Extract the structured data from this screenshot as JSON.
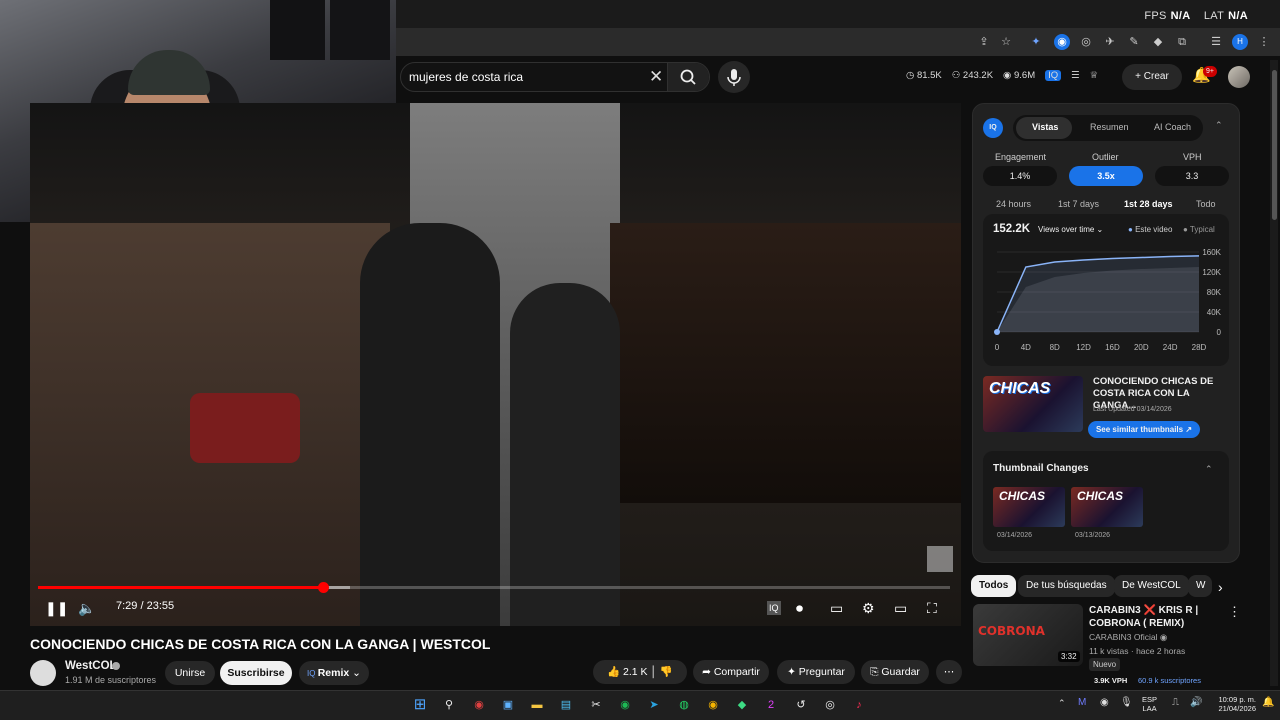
{
  "overlay": {
    "fps_label": "FPS",
    "fps_value": "N/A",
    "lat_label": "LAT",
    "lat_value": "N/A"
  },
  "search": {
    "query": "mujeres de costa rica"
  },
  "header": {
    "stats": [
      "81.5K",
      "243.2K",
      "9.6M"
    ],
    "create_label": "Crear",
    "notifications": "9+"
  },
  "player": {
    "time": "7:29 / 23:55",
    "progress_fraction": 0.313,
    "buffer_fraction": 0.342
  },
  "video": {
    "title": "CONOCIENDO CHICAS DE COSTA RICA CON LA GANGA | WESTCOL",
    "channel": "WestCOL",
    "subscribers": "1.91 M de suscriptores",
    "join_label": "Unirse",
    "subscribe_label": "Suscribirse",
    "remix_label": "Remix",
    "likes": "2.1 K",
    "share_label": "Compartir",
    "ask_label": "Preguntar",
    "save_label": "Guardar"
  },
  "iq": {
    "logo": "IQ",
    "tabs": [
      "Vistas",
      "Resumen",
      "AI Coach"
    ],
    "metrics": [
      {
        "label": "Engagement",
        "value": "1.4%"
      },
      {
        "label": "Outlier",
        "value": "3.5x"
      },
      {
        "label": "VPH",
        "value": "3.3"
      }
    ],
    "ranges": [
      "24 hours",
      "1st 7 days",
      "1st 28 days",
      "Todo"
    ],
    "chart_views": "152.2K",
    "chart_mode": "Views over time",
    "legend_this": "Este video",
    "legend_typical": "Typical",
    "thumb_title": "CONOCIENDO CHICAS DE COSTA RICA CON LA GANGA...",
    "thumb_updated": "Last Updated 03/14/2026",
    "similar_label": "See similar thumbnails",
    "changes_title": "Thumbnail Changes",
    "change_dates": [
      "03/14/2026",
      "03/13/2026"
    ],
    "thumb_text": "CHICAS"
  },
  "chart_data": {
    "type": "area",
    "title": "",
    "x": [
      "0",
      "4D",
      "8D",
      "12D",
      "16D",
      "20D",
      "24D",
      "28D"
    ],
    "y_ticks": [
      "160K",
      "120K",
      "80K",
      "40K",
      "0"
    ],
    "ylim": [
      0,
      160000
    ],
    "series": [
      {
        "name": "Este video",
        "values": [
          0,
          130000,
          140000,
          144000,
          147000,
          149000,
          151000,
          152200
        ]
      },
      {
        "values": [
          0,
          90000,
          110000,
          118000,
          123000,
          126000,
          128000,
          130000
        ]
      }
    ],
    "grid": true,
    "legend": "top-right"
  },
  "chips": [
    "Todos",
    "De tus búsquedas",
    "De WestCOL",
    "W"
  ],
  "recommended": {
    "title": "CARABIN3 ❌ KRIS R | COBRONA ( REMIX)",
    "thumb_text": "COBRONA",
    "channel": "CARABIN3 Oficial",
    "meta": "11 k vistas · hace 2 horas",
    "badge": "Nuevo",
    "duration": "3:32",
    "vph": "3.9K VPH",
    "subs": "60.9 k suscriptores"
  },
  "tray": {
    "lang1": "ESP",
    "lang2": "LAA",
    "time": "10:09 p. m.",
    "date": "21/04/2026"
  },
  "colors": {
    "accent": "#1a73e8",
    "youtube_red": "#ff0000"
  }
}
